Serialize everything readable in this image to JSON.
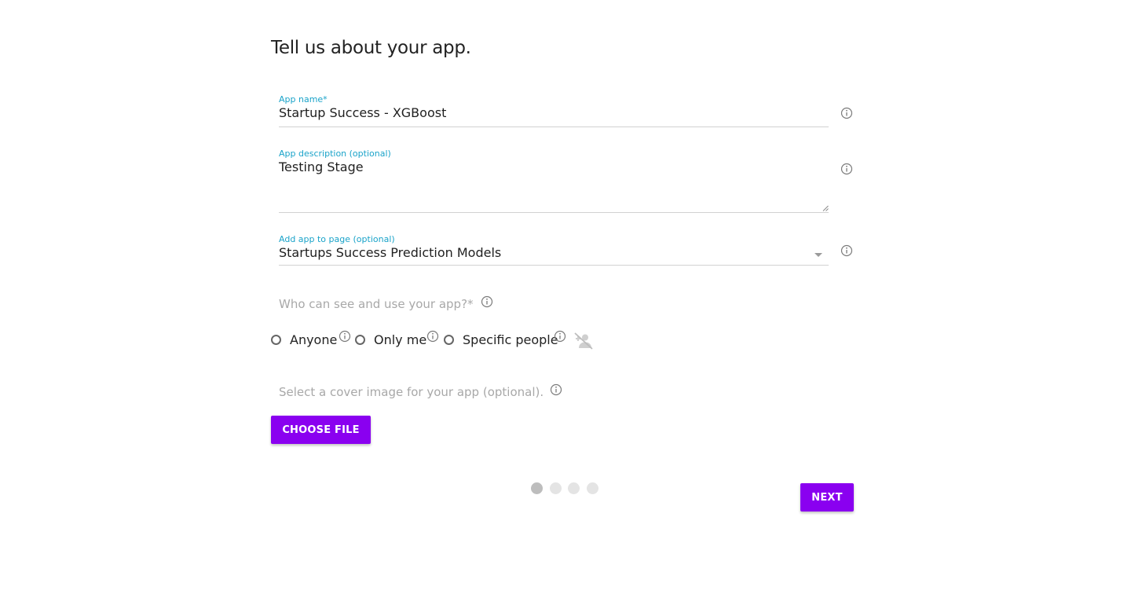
{
  "page": {
    "title": "Tell us about your app."
  },
  "form": {
    "app_name": {
      "label": "App name*",
      "value": "Startup Success - XGBoost"
    },
    "app_description": {
      "label": "App description (optional)",
      "value": "Testing Stage"
    },
    "add_to_page": {
      "label": "Add app to page (optional)",
      "value": "Startups Success Prediction Models"
    },
    "visibility": {
      "label": "Who can see and use your app?*",
      "options": [
        {
          "label": "Anyone",
          "selected": false
        },
        {
          "label": "Only me",
          "selected": false
        },
        {
          "label": "Specific people",
          "selected": false
        }
      ]
    },
    "cover_image": {
      "label": "Select a cover image for your app (optional).",
      "button_label": "CHOOSE FILE"
    }
  },
  "stepper": {
    "total_steps": 4,
    "current_step": 1
  },
  "footer": {
    "next_label": "NEXT"
  },
  "colors": {
    "accent": "#8a00f0",
    "label_blue": "#1aa3c9",
    "muted_text": "#a8a8a8",
    "icon_gray": "#7a7a7a"
  },
  "icons": {
    "info": "info-circle-icon",
    "people": "remove-person-icon",
    "caret": "chevron-down-icon"
  }
}
